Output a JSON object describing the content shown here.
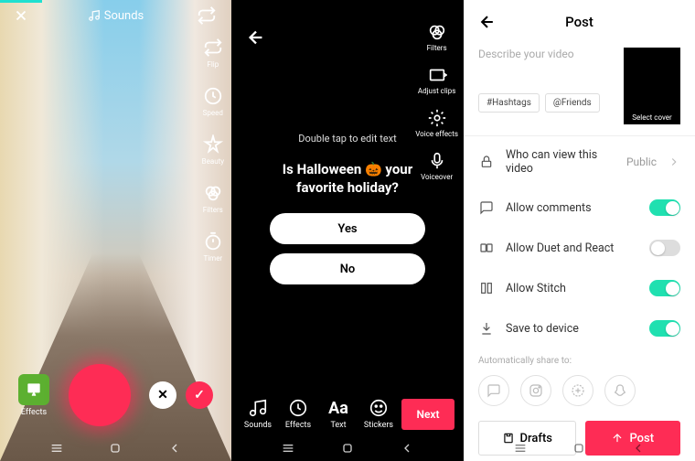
{
  "screen1": {
    "sounds_label": "Sounds",
    "tools": [
      "Flip",
      "Speed",
      "Beauty",
      "Filters",
      "Timer"
    ],
    "effects_label": "Effects"
  },
  "screen2": {
    "tools": [
      {
        "label": "Filters"
      },
      {
        "label": "Adjust clips"
      },
      {
        "label": "Voice effects"
      },
      {
        "label": "Voiceover"
      }
    ],
    "hint": "Double tap to edit text",
    "question": "Is Halloween 🎃 your favorite holiday?",
    "poll_yes": "Yes",
    "poll_no": "No",
    "bottom_tools": [
      "Sounds",
      "Effects",
      "Text",
      "Stickers"
    ],
    "next_label": "Next"
  },
  "screen3": {
    "title": "Post",
    "desc_placeholder": "Describe your video",
    "hashtags_btn": "#Hashtags",
    "friends_btn": "@Friends",
    "cover_label": "Select cover",
    "settings": {
      "privacy": {
        "label": "Who can view this video",
        "value": "Public"
      },
      "comments": {
        "label": "Allow comments",
        "on": true
      },
      "duet": {
        "label": "Allow Duet and React",
        "on": false
      },
      "stitch": {
        "label": "Allow Stitch",
        "on": true
      },
      "save": {
        "label": "Save to device",
        "on": true
      }
    },
    "share_label": "Automatically share to:",
    "drafts_btn": "Drafts",
    "post_btn": "Post"
  }
}
